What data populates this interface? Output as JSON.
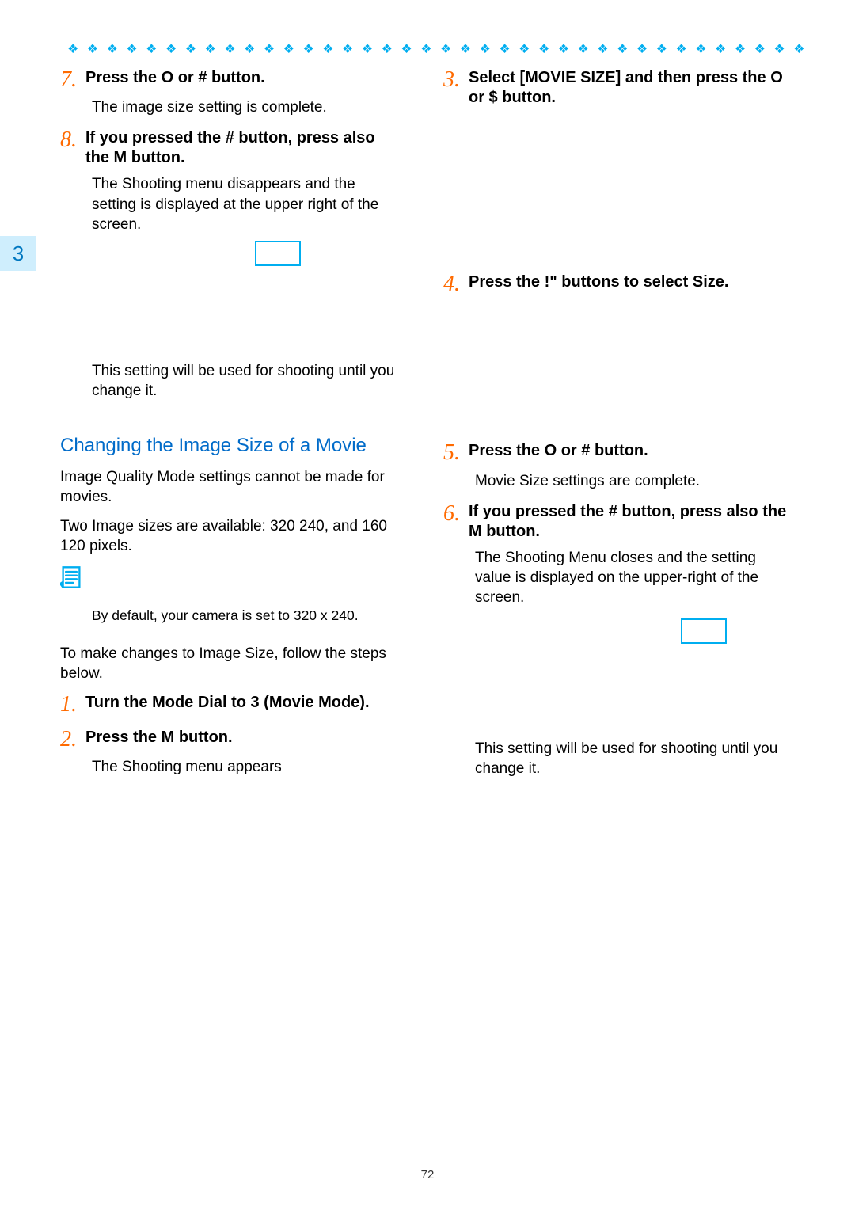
{
  "accent_color": "#00aef0",
  "step_number_color": "#ff6a00",
  "section_head_color": "#006bc9",
  "side_tab_bg": "#cfeefd",
  "side_tab": "3",
  "page_number": "72",
  "diamonds": "❖ ❖ ❖ ❖ ❖ ❖ ❖ ❖ ❖ ❖ ❖ ❖ ❖ ❖ ❖ ❖ ❖ ❖ ❖ ❖ ❖ ❖ ❖ ❖ ❖ ❖ ❖ ❖ ❖ ❖ ❖ ❖ ❖ ❖ ❖ ❖ ❖ ❖ ❖ ❖ ❖ ❖ ❖ ❖ ❖ ❖ ❖ ❖ ❖ ❖ ❖ ❖ ❖ ❖ ❖ ❖ ❖ ❖ ❖ ❖ ❖",
  "left": {
    "step7": {
      "num": "7.",
      "head": "Press the O    or #  button.",
      "body": "The image size setting is complete."
    },
    "step8": {
      "num": "8.",
      "head": "If you pressed the #  button, press also the M          button.",
      "body": "The Shooting menu disappears and the setting is displayed at the upper right of the screen."
    },
    "persist": "This setting will be used for shooting until you change it.",
    "section_head": "Changing the Image Size of a Movie",
    "para1": "Image Quality Mode settings cannot be made for movies.",
    "para2": "Two Image sizes are available: 320    240, and 160    120 pixels.",
    "note": "By default, your camera is set to 320 x 240.",
    "para3": "To make changes to Image Size, follow the steps below.",
    "step1": {
      "num": "1.",
      "head": "Turn the Mode Dial to 3    (Movie Mode)."
    },
    "step2": {
      "num": "2.",
      "head": "Press the M          button.",
      "body": "The Shooting menu appears"
    }
  },
  "right": {
    "step3": {
      "num": "3.",
      "head": "Select  [MOVIE SIZE] and then press the O    or $  button."
    },
    "step4": {
      "num": "4.",
      "head": "Press  the !\"       buttons to select Size."
    },
    "step5": {
      "num": "5.",
      "head": "Press the O    or #  button.",
      "body": "Movie Size settings are complete."
    },
    "step6": {
      "num": "6.",
      "head": "If you pressed the #  button, press also the M           button.",
      "body": "The Shooting Menu closes and the setting value is displayed on the upper-right of the screen."
    },
    "persist": "This setting will be used for shooting until you change it."
  }
}
